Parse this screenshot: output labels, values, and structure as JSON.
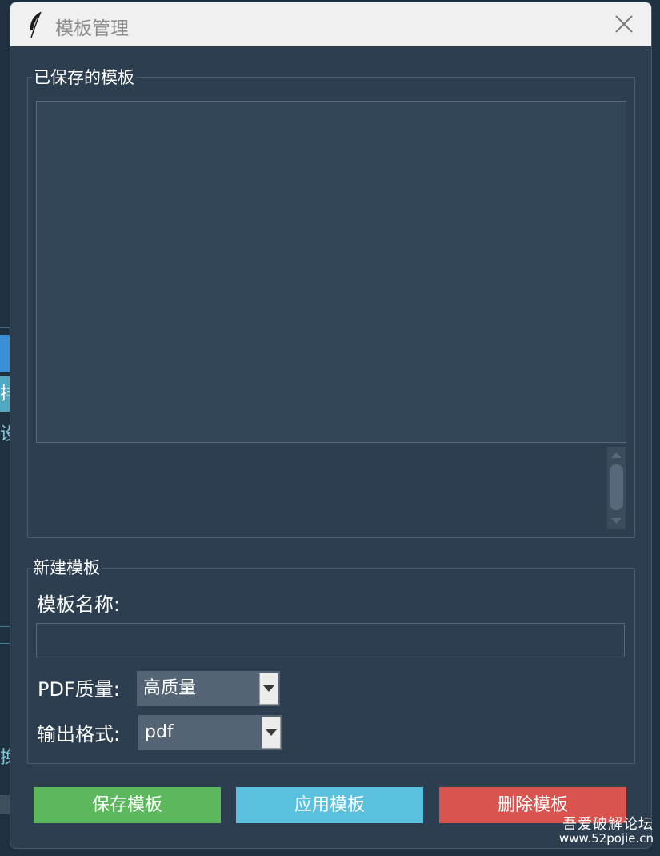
{
  "window": {
    "title": "模板管理",
    "app_icon": "feather-icon",
    "close_icon": "close-icon"
  },
  "saved_group": {
    "label": "已保存的模板",
    "items": []
  },
  "new_group": {
    "label": "新建模板",
    "name_label": "模板名称:",
    "name_value": "",
    "pdf_quality_label": "PDF质量:",
    "pdf_quality_value": "高质量",
    "output_format_label": "输出格式:",
    "output_format_value": "pdf"
  },
  "buttons": {
    "save": "保存模板",
    "apply": "应用模板",
    "delete": "删除模板"
  },
  "colors": {
    "dialog_bg": "#2c3e50",
    "save_button": "#5cb85c",
    "apply_button": "#5bc0de",
    "delete_button": "#d9534f"
  },
  "background_app": {
    "char_1": "排",
    "char_2": "设",
    "char_3": "换"
  },
  "watermark": {
    "line1": "吾爱破解论坛",
    "line2": "www.52pojie.cn"
  }
}
